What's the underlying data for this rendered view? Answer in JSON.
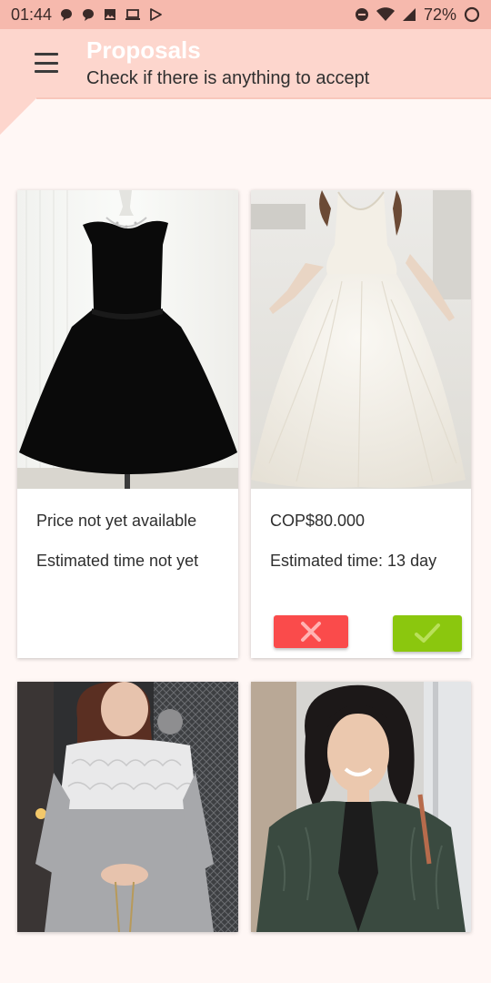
{
  "status_bar": {
    "time": "01:44",
    "battery": "72%",
    "icons": [
      "chat-bubble-icon",
      "chat-bubble-icon",
      "image-icon",
      "laptop-icon",
      "play-store-icon",
      "do-not-disturb-icon",
      "wifi-icon",
      "signal-icon",
      "battery-ring-icon"
    ]
  },
  "header": {
    "title": "Proposals",
    "subtitle": "Check if there is anything to accept",
    "menu_icon": "menu-icon"
  },
  "colors": {
    "status_bar": "#f6b9ad",
    "header": "#fdd6cd",
    "reject": "#fa4b4b",
    "accept": "#8bc70e",
    "background": "#fff7f5"
  },
  "proposals": [
    {
      "image": "black-dress-photo",
      "price": "Price not yet available",
      "time": "Estimated time not yet",
      "actions": false
    },
    {
      "image": "white-wedding-dress-photo",
      "price": "COP$80.000",
      "time": "Estimated time: 13 day",
      "actions": true,
      "reject_icon": "close-icon",
      "accept_icon": "check-icon"
    },
    {
      "image": "grey-lace-dress-photo"
    },
    {
      "image": "green-coat-woman-photo"
    }
  ]
}
